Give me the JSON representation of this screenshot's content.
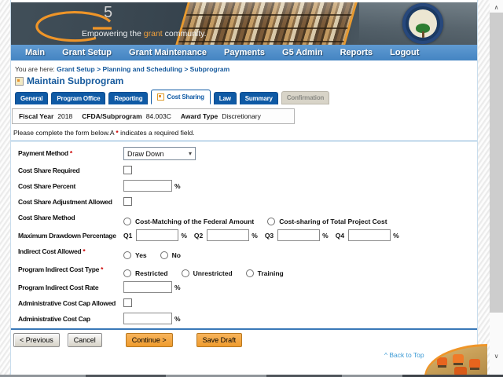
{
  "colors": {
    "nav_blue": "#4484c2",
    "tab_blue": "#0f5aa5",
    "link_blue": "#15599c",
    "accent_orange": "#ef9528",
    "button_orange": "#f2a440",
    "button_gray": "#d6d2c6",
    "required_red": "#cc0000",
    "back_to_top_blue": "#3d9bd5"
  },
  "header": {
    "logo_five": "5",
    "tagline_before": "Empowering the ",
    "tagline_highlight": "grant",
    "tagline_after": " community."
  },
  "nav": {
    "items": [
      "Main",
      "Grant Setup",
      "Grant Maintenance",
      "Payments",
      "G5 Admin",
      "Reports",
      "Logout"
    ]
  },
  "breadcrumb": {
    "prefix": "You are here:",
    "path": "Grant Setup > Planning and Scheduling > Subprogram"
  },
  "page": {
    "title": "Maintain Subprogram"
  },
  "tabs": [
    {
      "label": "General",
      "state": "inactive"
    },
    {
      "label": "Program Office",
      "state": "inactive"
    },
    {
      "label": "Reporting",
      "state": "inactive"
    },
    {
      "label": "Cost Sharing",
      "state": "active"
    },
    {
      "label": "Law",
      "state": "inactive"
    },
    {
      "label": "Summary",
      "state": "inactive"
    },
    {
      "label": "Confirmation",
      "state": "disabled"
    }
  ],
  "summary_bar": {
    "fields": [
      {
        "label": "Fiscal Year",
        "value": "2018"
      },
      {
        "label": "CFDA/Subprogram",
        "value": "84.003C"
      },
      {
        "label": "Award Type",
        "value": "Discretionary"
      }
    ]
  },
  "instructions": {
    "before": "Please complete the form below.A ",
    "marker": "*",
    "after": " indicates a required field."
  },
  "form": {
    "required_marker": "*",
    "percent_suffix": "%",
    "payment_method": {
      "label": "Payment Method",
      "required": true,
      "value": "Draw Down"
    },
    "cost_share_required": {
      "label": "Cost Share Required",
      "checked": false
    },
    "cost_share_percent": {
      "label": "Cost Share Percent",
      "value": ""
    },
    "cost_share_adjustment_allowed": {
      "label": "Cost Share Adjustment Allowed",
      "checked": false
    },
    "cost_share_method": {
      "label": "Cost Share Method",
      "options": [
        "Cost-Matching of the Federal Amount",
        "Cost-sharing of Total Project Cost"
      ],
      "selected": null
    },
    "maximum_drawdown_percentage": {
      "label": "Maximum Drawdown Percentage",
      "quarters": [
        "Q1",
        "Q2",
        "Q3",
        "Q4"
      ],
      "values": [
        "",
        "",
        "",
        ""
      ]
    },
    "indirect_cost_allowed": {
      "label": "Indirect Cost Allowed",
      "required": true,
      "options": [
        "Yes",
        "No"
      ],
      "selected": null
    },
    "program_indirect_cost_type": {
      "label": "Program Indirect Cost Type",
      "required": true,
      "options": [
        "Restricted",
        "Unrestricted",
        "Training"
      ],
      "selected": null
    },
    "program_indirect_cost_rate": {
      "label": "Program Indirect Cost Rate",
      "value": ""
    },
    "administrative_cost_cap_allowed": {
      "label": "Administrative Cost Cap Allowed",
      "checked": false
    },
    "administrative_cost_cap": {
      "label": "Administrative Cost Cap",
      "value": ""
    }
  },
  "buttons": {
    "previous": "< Previous",
    "cancel": "Cancel",
    "continue": "Continue >",
    "save_draft": "Save Draft"
  },
  "back_to_top": {
    "caret": "^",
    "label": "Back to Top"
  }
}
